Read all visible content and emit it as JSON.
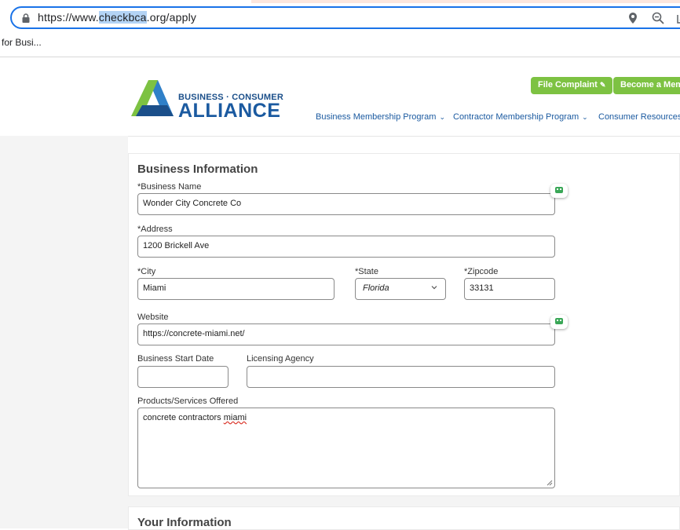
{
  "browser": {
    "url_prefix": "https://www.",
    "url_selected": "checkbca",
    "url_suffix": ".org/apply",
    "bookmark": "for Busi..."
  },
  "header": {
    "logo_top": "BUSINESS · CONSUMER",
    "logo_main": "ALLIANCE",
    "file_complaint": "File Complaint",
    "become_member": "Become a Membe",
    "nav": {
      "business": "Business Membership Program",
      "contractor": "Contractor Membership Program",
      "consumer": "Consumer Resources"
    }
  },
  "form": {
    "section_title": "Business Information",
    "business_name_label": "*Business Name",
    "business_name_value": "Wonder City Concrete Co",
    "address_label": "*Address",
    "address_value": "1200 Brickell Ave",
    "city_label": "*City",
    "city_value": "Miami",
    "state_label": "*State",
    "state_value": "Florida",
    "zip_label": "*Zipcode",
    "zip_value": "33131",
    "website_label": "Website",
    "website_value": "https://concrete-miami.net/",
    "start_date_label": "Business Start Date",
    "start_date_value": "",
    "licensing_label": "Licensing Agency",
    "licensing_value": "",
    "products_label": "Products/Services Offered",
    "products_value_a": "concrete contractors ",
    "products_value_b": "miami"
  },
  "next_section_title": "Your Information",
  "colors": {
    "brand_blue": "#1b5aa0",
    "brand_green": "#7dc242",
    "focus_blue": "#1a73e8"
  }
}
